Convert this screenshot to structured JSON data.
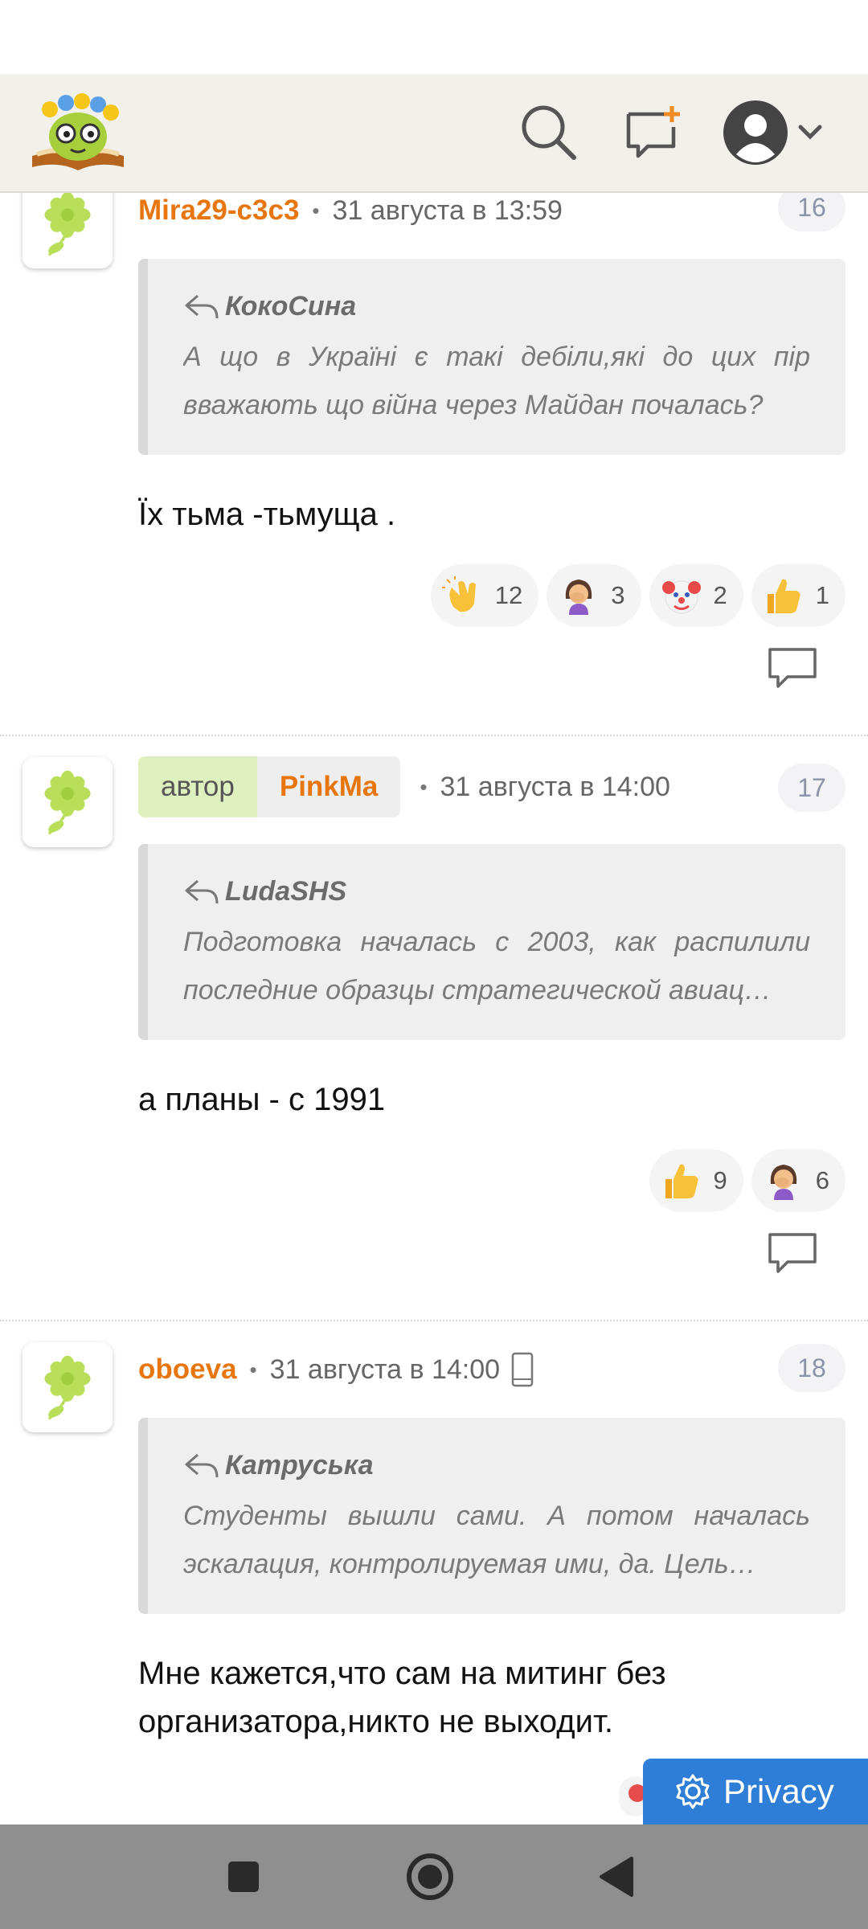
{
  "comments": [
    {
      "username": "Mira29-с3с3",
      "date": "31 августа в 13:59",
      "number": "16",
      "quote_author": "КокоСина",
      "quote_text": "А що в Україні є такі дебіли,які до цих пір вважають що війна через Майдан почалась?",
      "body": "Їх тьма -тьмуща .",
      "reactions": [
        {
          "icon": "clapping-hands-emoji",
          "count": "12"
        },
        {
          "icon": "facepalm-woman-emoji",
          "count": "3"
        },
        {
          "icon": "clown-face-emoji",
          "count": "2"
        },
        {
          "icon": "thumbs-up-emoji",
          "count": "1"
        }
      ]
    },
    {
      "author_label": "автор",
      "username": "PinkMa",
      "date": "31 августа в 14:00",
      "number": "17",
      "quote_author": "LudaSHS",
      "quote_text": "Подготовка началась с 2003, как распилили последние образцы стратегической авиац…",
      "body": "а планы - с 1991",
      "reactions": [
        {
          "icon": "thumbs-up-emoji",
          "count": "9"
        },
        {
          "icon": "facepalm-woman-emoji",
          "count": "6"
        }
      ]
    },
    {
      "username": "oboeva",
      "date": "31 августа в 14:00",
      "device_icon": "mobile-phone-icon",
      "number": "18",
      "quote_author": "Катруська",
      "quote_text": "Студенты вышли сами. А потом началась эскалация, контролируемая ими, да. Цель…",
      "body": "Мне кажется,что сам на митинг без организатора,никто не выходит."
    }
  ],
  "privacy_label": "Privacy",
  "colors": {
    "accent_orange": "#e8760f",
    "header_bg": "#f1f0ea",
    "privacy_blue": "#2e7dd6",
    "navbar_bg": "#8f8f8f"
  }
}
